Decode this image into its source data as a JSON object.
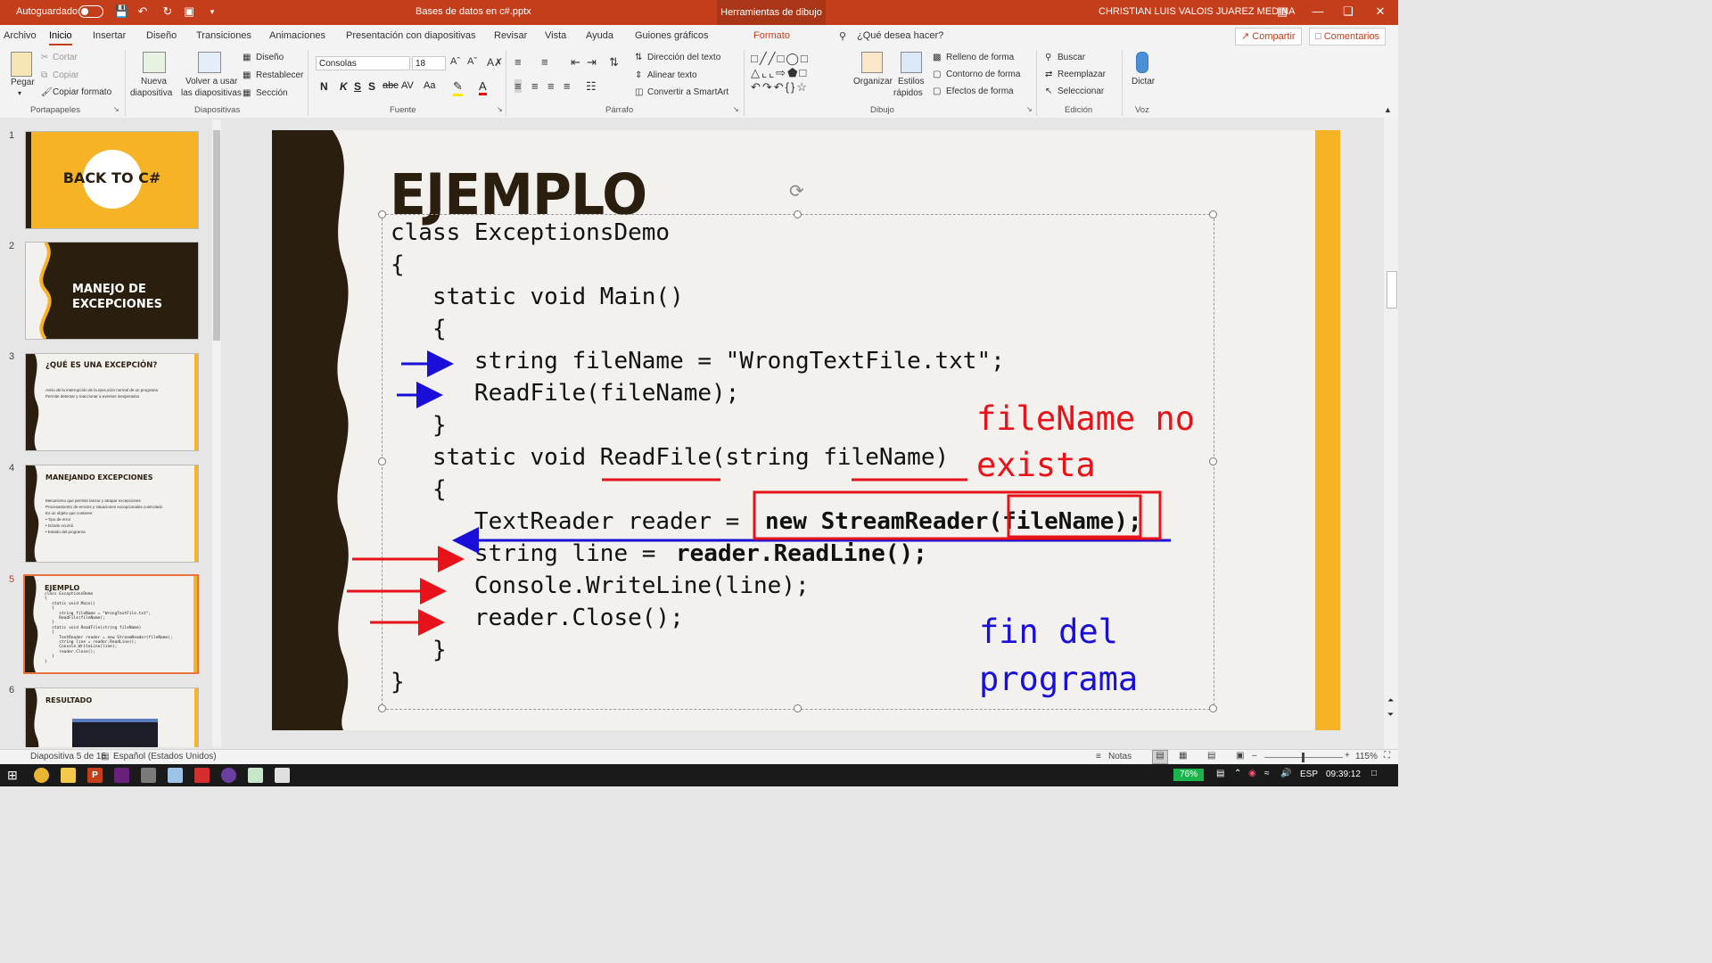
{
  "titlebar": {
    "autosave_label": "Autoguardado",
    "document_title": "Bases de datos en c#.pptx",
    "context_tab": "Herramientas de dibujo",
    "user_name": "CHRISTIAN LUIS VALOIS JUAREZ MEDINA",
    "accent_color": "#c43e1c"
  },
  "menu": {
    "tabs": [
      "Archivo",
      "Inicio",
      "Insertar",
      "Diseño",
      "Transiciones",
      "Animaciones",
      "Presentación con diapositivas",
      "Revisar",
      "Vista",
      "Ayuda",
      "Guiones gráficos",
      "Formato"
    ],
    "active_tab": "Inicio",
    "tell_me": "¿Qué desea hacer?",
    "share": "Compartir",
    "comments": "Comentarios"
  },
  "ribbon": {
    "clipboard": {
      "paste": "Pegar",
      "cut": "Cortar",
      "copy": "Copiar",
      "format_painter": "Copiar formato",
      "group": "Portapapeles"
    },
    "slides": {
      "new_slide_1": "Nueva",
      "new_slide_2": "diapositiva",
      "reuse_1": "Volver a usar",
      "reuse_2": "las diapositivas",
      "layout": "Diseño",
      "reset": "Restablecer",
      "section": "Sección",
      "group": "Diapositivas"
    },
    "font": {
      "name": "Consolas",
      "size": "18",
      "group": "Fuente",
      "bold": "N",
      "italic": "K",
      "underline": "S",
      "shadow": "S",
      "strike": "abc",
      "spacing": "AV",
      "case": "Aa"
    },
    "paragraph": {
      "text_direction": "Dirección del texto",
      "align_text": "Alinear texto",
      "smartart": "Convertir a SmartArt",
      "group": "Párrafo"
    },
    "drawing": {
      "arrange": "Organizar",
      "quick_styles_1": "Estilos",
      "quick_styles_2": "rápidos",
      "fill": "Relleno de forma",
      "outline": "Contorno de forma",
      "effects": "Efectos de forma",
      "group": "Dibujo"
    },
    "editing": {
      "find": "Buscar",
      "replace": "Reemplazar",
      "select": "Seleccionar",
      "group": "Edición"
    },
    "voice": {
      "dictate": "Dictar",
      "group": "Voz"
    }
  },
  "thumbnails": [
    {
      "num": "1",
      "title": "BACK TO C#"
    },
    {
      "num": "2",
      "title_1": "MANEJO DE",
      "title_2": "EXCEPCIONES"
    },
    {
      "num": "3",
      "title": "¿QUÉ ES UNA EXCEPCIÓN?",
      "line1": "Aviso de la interrupción de la ejecución normal de un programa",
      "line2": "Permite detectar y reaccionar a eventos inesperados"
    },
    {
      "num": "4",
      "title": "MANEJANDO EXCEPCIONES",
      "line1": "Mecanismo que permite lanzar y atrapar excepciones",
      "line2": "Procesamiento de errores y situaciones excepcionales controlado",
      "line3": "Es un objeto que contiene:",
      "line4": "• Tipo de error",
      "line5": "• Dónde ocurrió",
      "line6": "• Estado del programa"
    },
    {
      "num": "5",
      "title": "EJEMPLO"
    },
    {
      "num": "6",
      "title": "RESULTADO"
    }
  ],
  "slide": {
    "title": "EJEMPLO",
    "code": [
      "class ExceptionsDemo",
      "{",
      "   static void Main()",
      "   {",
      "      string fileName = \"WrongTextFile.txt\";",
      "      ReadFile(fileName);",
      "   }",
      "   static void ReadFile(string fileName)",
      "   {",
      "      TextReader reader = ",
      "new StreamReader(fileName);",
      "      string line = ",
      "reader.ReadLine();",
      "      Console.WriteLine(line);",
      "      reader.Close();",
      "   }",
      "}"
    ],
    "note_red_1": "fileName no",
    "note_red_2": "exista",
    "note_blue_1": "fin del",
    "note_blue_2": "programa",
    "colors": {
      "dark": "#2a1f0f",
      "accent": "#f5b325",
      "red": "#e8121a",
      "blue": "#1a0fd8"
    }
  },
  "status": {
    "slide_of": "Diapositiva 5 de 16",
    "language": "Español (Estados Unidos)",
    "notes": "Notas",
    "zoom": "115%"
  },
  "taskbar": {
    "battery": "76%",
    "lang": "ESP",
    "time": "09:39:12"
  }
}
